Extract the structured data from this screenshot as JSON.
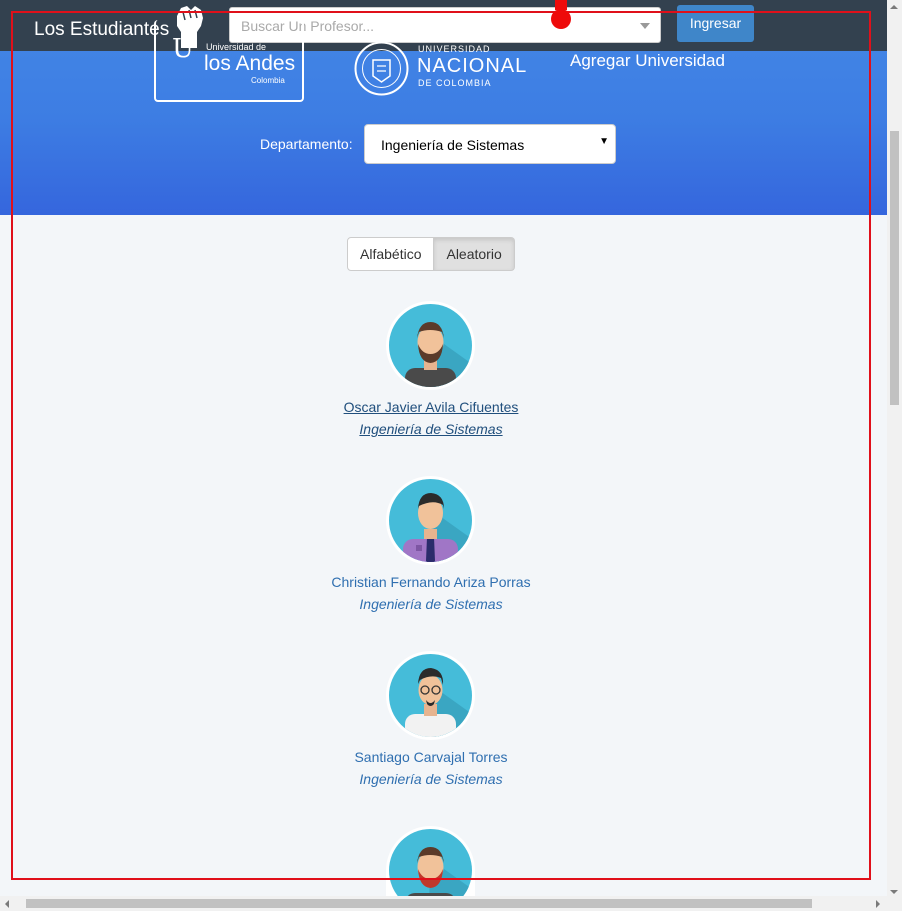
{
  "navbar": {
    "brand": "Los Estudiantes",
    "search_placeholder": "Buscar Un Profesor...",
    "login_label": "Ingresar"
  },
  "universities": {
    "andes": {
      "top": "Universidad de",
      "name": "los Andes",
      "country": "Colombia"
    },
    "nacional": {
      "top": "UNIVERSIDAD",
      "name": "NACIONAL",
      "sub": "DE COLOMBIA"
    },
    "add_label": "Agregar Universidad"
  },
  "filter": {
    "department_label": "Departamento:",
    "department_value": "Ingeniería de Sistemas"
  },
  "sort": {
    "alphabetic_label": "Alfabético",
    "random_label": "Aleatorio",
    "active": "Aleatorio"
  },
  "professors": [
    {
      "name": "Oscar Javier Avila Cifuentes",
      "department": "Ingeniería de Sistemas"
    },
    {
      "name": "Christian Fernando Ariza Porras",
      "department": "Ingeniería de Sistemas"
    },
    {
      "name": "Santiago Carvajal Torres",
      "department": "Ingeniería de Sistemas"
    }
  ],
  "colors": {
    "navbar": "#33414f",
    "hero_top": "#4488e6",
    "hero_bottom": "#3566dd",
    "link": "#2f6fb0",
    "annotation": "#e0101a"
  }
}
